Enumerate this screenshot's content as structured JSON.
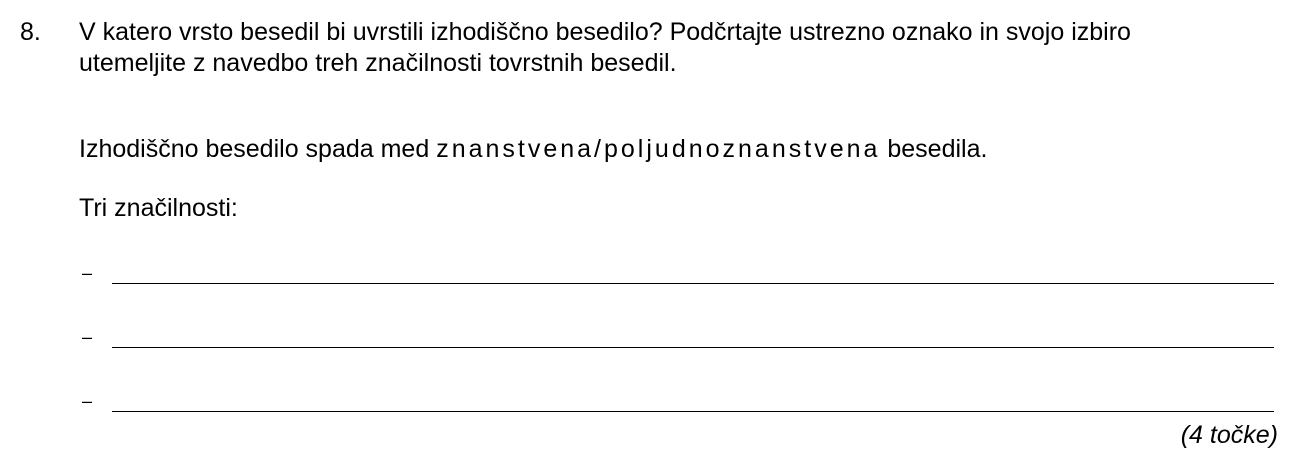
{
  "question": {
    "number": "8.",
    "line1": "V katero vrsto besedil bi uvrstili izhodiščno besedilo? Podčrtajte ustrezno oznako in svojo izbiro",
    "line2": "utemeljite z navedbo treh značilnosti tovrstnih besedil."
  },
  "statement": {
    "prefix": "Izhodiščno besedilo spada med ",
    "options": "znanstvena/poljudnoznanstvena",
    "suffix": " besedila."
  },
  "features_label": "Tri značilnosti:",
  "answer_lines": [
    {
      "dash": "–"
    },
    {
      "dash": "–"
    },
    {
      "dash": "–"
    }
  ],
  "points": "(4 točke)"
}
